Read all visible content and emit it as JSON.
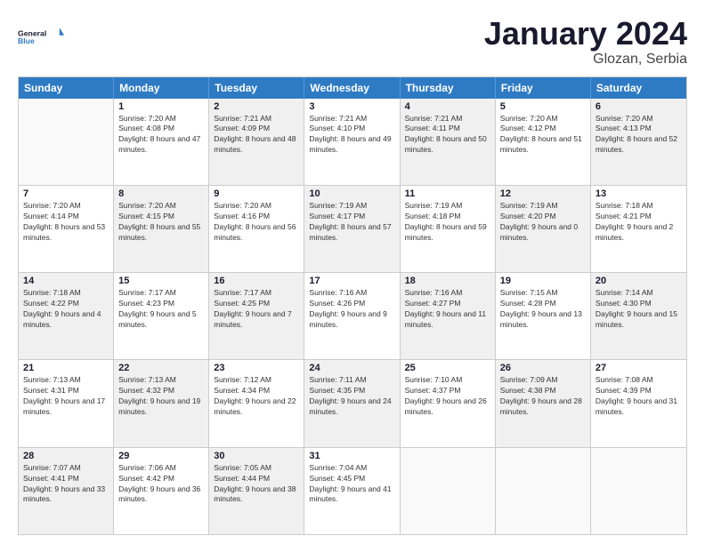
{
  "logo": {
    "general": "General",
    "blue": "Blue"
  },
  "title": {
    "month": "January 2024",
    "location": "Glozan, Serbia"
  },
  "header": {
    "days": [
      "Sunday",
      "Monday",
      "Tuesday",
      "Wednesday",
      "Thursday",
      "Friday",
      "Saturday"
    ]
  },
  "rows": [
    [
      {
        "day": "",
        "sunrise": "",
        "sunset": "",
        "daylight": "",
        "shaded": false,
        "empty": true
      },
      {
        "day": "1",
        "sunrise": "Sunrise: 7:20 AM",
        "sunset": "Sunset: 4:08 PM",
        "daylight": "Daylight: 8 hours and 47 minutes.",
        "shaded": false
      },
      {
        "day": "2",
        "sunrise": "Sunrise: 7:21 AM",
        "sunset": "Sunset: 4:09 PM",
        "daylight": "Daylight: 8 hours and 48 minutes.",
        "shaded": true
      },
      {
        "day": "3",
        "sunrise": "Sunrise: 7:21 AM",
        "sunset": "Sunset: 4:10 PM",
        "daylight": "Daylight: 8 hours and 49 minutes.",
        "shaded": false
      },
      {
        "day": "4",
        "sunrise": "Sunrise: 7:21 AM",
        "sunset": "Sunset: 4:11 PM",
        "daylight": "Daylight: 8 hours and 50 minutes.",
        "shaded": true
      },
      {
        "day": "5",
        "sunrise": "Sunrise: 7:20 AM",
        "sunset": "Sunset: 4:12 PM",
        "daylight": "Daylight: 8 hours and 51 minutes.",
        "shaded": false
      },
      {
        "day": "6",
        "sunrise": "Sunrise: 7:20 AM",
        "sunset": "Sunset: 4:13 PM",
        "daylight": "Daylight: 8 hours and 52 minutes.",
        "shaded": true
      }
    ],
    [
      {
        "day": "7",
        "sunrise": "Sunrise: 7:20 AM",
        "sunset": "Sunset: 4:14 PM",
        "daylight": "Daylight: 8 hours and 53 minutes.",
        "shaded": false
      },
      {
        "day": "8",
        "sunrise": "Sunrise: 7:20 AM",
        "sunset": "Sunset: 4:15 PM",
        "daylight": "Daylight: 8 hours and 55 minutes.",
        "shaded": true
      },
      {
        "day": "9",
        "sunrise": "Sunrise: 7:20 AM",
        "sunset": "Sunset: 4:16 PM",
        "daylight": "Daylight: 8 hours and 56 minutes.",
        "shaded": false
      },
      {
        "day": "10",
        "sunrise": "Sunrise: 7:19 AM",
        "sunset": "Sunset: 4:17 PM",
        "daylight": "Daylight: 8 hours and 57 minutes.",
        "shaded": true
      },
      {
        "day": "11",
        "sunrise": "Sunrise: 7:19 AM",
        "sunset": "Sunset: 4:18 PM",
        "daylight": "Daylight: 8 hours and 59 minutes.",
        "shaded": false
      },
      {
        "day": "12",
        "sunrise": "Sunrise: 7:19 AM",
        "sunset": "Sunset: 4:20 PM",
        "daylight": "Daylight: 9 hours and 0 minutes.",
        "shaded": true
      },
      {
        "day": "13",
        "sunrise": "Sunrise: 7:18 AM",
        "sunset": "Sunset: 4:21 PM",
        "daylight": "Daylight: 9 hours and 2 minutes.",
        "shaded": false
      }
    ],
    [
      {
        "day": "14",
        "sunrise": "Sunrise: 7:18 AM",
        "sunset": "Sunset: 4:22 PM",
        "daylight": "Daylight: 9 hours and 4 minutes.",
        "shaded": true
      },
      {
        "day": "15",
        "sunrise": "Sunrise: 7:17 AM",
        "sunset": "Sunset: 4:23 PM",
        "daylight": "Daylight: 9 hours and 5 minutes.",
        "shaded": false
      },
      {
        "day": "16",
        "sunrise": "Sunrise: 7:17 AM",
        "sunset": "Sunset: 4:25 PM",
        "daylight": "Daylight: 9 hours and 7 minutes.",
        "shaded": true
      },
      {
        "day": "17",
        "sunrise": "Sunrise: 7:16 AM",
        "sunset": "Sunset: 4:26 PM",
        "daylight": "Daylight: 9 hours and 9 minutes.",
        "shaded": false
      },
      {
        "day": "18",
        "sunrise": "Sunrise: 7:16 AM",
        "sunset": "Sunset: 4:27 PM",
        "daylight": "Daylight: 9 hours and 11 minutes.",
        "shaded": true
      },
      {
        "day": "19",
        "sunrise": "Sunrise: 7:15 AM",
        "sunset": "Sunset: 4:28 PM",
        "daylight": "Daylight: 9 hours and 13 minutes.",
        "shaded": false
      },
      {
        "day": "20",
        "sunrise": "Sunrise: 7:14 AM",
        "sunset": "Sunset: 4:30 PM",
        "daylight": "Daylight: 9 hours and 15 minutes.",
        "shaded": true
      }
    ],
    [
      {
        "day": "21",
        "sunrise": "Sunrise: 7:13 AM",
        "sunset": "Sunset: 4:31 PM",
        "daylight": "Daylight: 9 hours and 17 minutes.",
        "shaded": false
      },
      {
        "day": "22",
        "sunrise": "Sunrise: 7:13 AM",
        "sunset": "Sunset: 4:32 PM",
        "daylight": "Daylight: 9 hours and 19 minutes.",
        "shaded": true
      },
      {
        "day": "23",
        "sunrise": "Sunrise: 7:12 AM",
        "sunset": "Sunset: 4:34 PM",
        "daylight": "Daylight: 9 hours and 22 minutes.",
        "shaded": false
      },
      {
        "day": "24",
        "sunrise": "Sunrise: 7:11 AM",
        "sunset": "Sunset: 4:35 PM",
        "daylight": "Daylight: 9 hours and 24 minutes.",
        "shaded": true
      },
      {
        "day": "25",
        "sunrise": "Sunrise: 7:10 AM",
        "sunset": "Sunset: 4:37 PM",
        "daylight": "Daylight: 9 hours and 26 minutes.",
        "shaded": false
      },
      {
        "day": "26",
        "sunrise": "Sunrise: 7:09 AM",
        "sunset": "Sunset: 4:38 PM",
        "daylight": "Daylight: 9 hours and 28 minutes.",
        "shaded": true
      },
      {
        "day": "27",
        "sunrise": "Sunrise: 7:08 AM",
        "sunset": "Sunset: 4:39 PM",
        "daylight": "Daylight: 9 hours and 31 minutes.",
        "shaded": false
      }
    ],
    [
      {
        "day": "28",
        "sunrise": "Sunrise: 7:07 AM",
        "sunset": "Sunset: 4:41 PM",
        "daylight": "Daylight: 9 hours and 33 minutes.",
        "shaded": true
      },
      {
        "day": "29",
        "sunrise": "Sunrise: 7:06 AM",
        "sunset": "Sunset: 4:42 PM",
        "daylight": "Daylight: 9 hours and 36 minutes.",
        "shaded": false
      },
      {
        "day": "30",
        "sunrise": "Sunrise: 7:05 AM",
        "sunset": "Sunset: 4:44 PM",
        "daylight": "Daylight: 9 hours and 38 minutes.",
        "shaded": true
      },
      {
        "day": "31",
        "sunrise": "Sunrise: 7:04 AM",
        "sunset": "Sunset: 4:45 PM",
        "daylight": "Daylight: 9 hours and 41 minutes.",
        "shaded": false
      },
      {
        "day": "",
        "sunrise": "",
        "sunset": "",
        "daylight": "",
        "shaded": false,
        "empty": true
      },
      {
        "day": "",
        "sunrise": "",
        "sunset": "",
        "daylight": "",
        "shaded": false,
        "empty": true
      },
      {
        "day": "",
        "sunrise": "",
        "sunset": "",
        "daylight": "",
        "shaded": false,
        "empty": true
      }
    ]
  ]
}
